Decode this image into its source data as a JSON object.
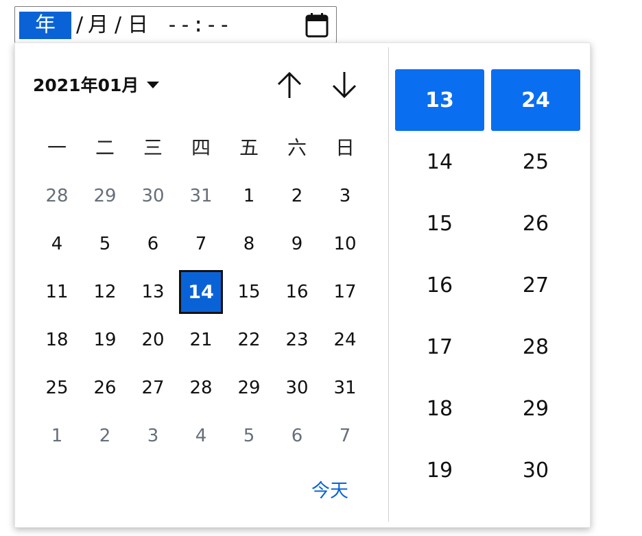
{
  "input": {
    "year_segment": "年",
    "separator": "/",
    "month_segment": "月",
    "day_segment": "日",
    "time_segment": "--:--",
    "calendar_icon": "calendar-icon"
  },
  "calendar": {
    "month_label": "2021年01月",
    "nav_up_icon": "arrow-up-icon",
    "nav_down_icon": "arrow-down-icon",
    "weekdays": [
      "一",
      "二",
      "三",
      "四",
      "五",
      "六",
      "日"
    ],
    "days": [
      {
        "label": "28",
        "muted": true
      },
      {
        "label": "29",
        "muted": true
      },
      {
        "label": "30",
        "muted": true
      },
      {
        "label": "31",
        "muted": true
      },
      {
        "label": "1"
      },
      {
        "label": "2"
      },
      {
        "label": "3"
      },
      {
        "label": "4"
      },
      {
        "label": "5"
      },
      {
        "label": "6"
      },
      {
        "label": "7"
      },
      {
        "label": "8"
      },
      {
        "label": "9"
      },
      {
        "label": "10"
      },
      {
        "label": "11"
      },
      {
        "label": "12"
      },
      {
        "label": "13"
      },
      {
        "label": "14",
        "selected": true
      },
      {
        "label": "15"
      },
      {
        "label": "16"
      },
      {
        "label": "17"
      },
      {
        "label": "18"
      },
      {
        "label": "19"
      },
      {
        "label": "20"
      },
      {
        "label": "21"
      },
      {
        "label": "22"
      },
      {
        "label": "23"
      },
      {
        "label": "24"
      },
      {
        "label": "25"
      },
      {
        "label": "26"
      },
      {
        "label": "27"
      },
      {
        "label": "28"
      },
      {
        "label": "29"
      },
      {
        "label": "30"
      },
      {
        "label": "31"
      },
      {
        "label": "1",
        "muted": true
      },
      {
        "label": "2",
        "muted": true
      },
      {
        "label": "3",
        "muted": true
      },
      {
        "label": "4",
        "muted": true
      },
      {
        "label": "5",
        "muted": true
      },
      {
        "label": "6",
        "muted": true
      },
      {
        "label": "7",
        "muted": true
      }
    ],
    "today_label": "今天"
  },
  "time": {
    "hours": [
      "13",
      "14",
      "15",
      "16",
      "17",
      "18",
      "19"
    ],
    "minutes": [
      "24",
      "25",
      "26",
      "27",
      "28",
      "29",
      "30"
    ],
    "selected_hour": "13",
    "selected_minute": "24"
  },
  "colors": {
    "accent": "#0a63d6",
    "selected_time_bg": "#0a6ef0",
    "muted_text": "#666e7a"
  }
}
